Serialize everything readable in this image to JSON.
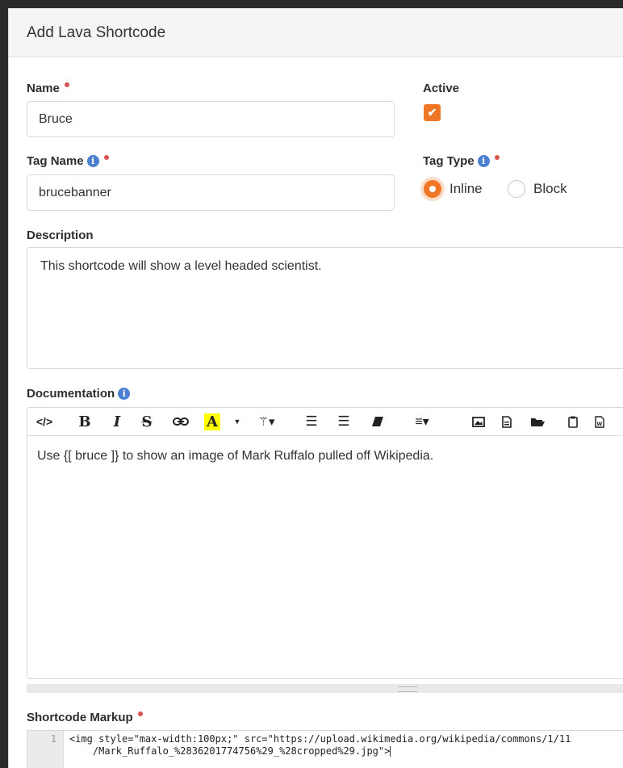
{
  "header": {
    "title": "Add Lava Shortcode"
  },
  "name": {
    "label": "Name",
    "value": "Bruce"
  },
  "active": {
    "label": "Active",
    "checked": true
  },
  "tag_name": {
    "label": "Tag Name",
    "value": "brucebanner"
  },
  "tag_type": {
    "label": "Tag Type",
    "options": [
      "Inline",
      "Block"
    ],
    "selected": "Inline"
  },
  "description": {
    "label": "Description",
    "value": "This shortcode will show a level headed scientist."
  },
  "documentation": {
    "label": "Documentation",
    "body": "Use {[ bruce ]} to show an image of Mark Ruffalo pulled off Wikipedia."
  },
  "markup": {
    "label": "Shortcode Markup",
    "line_number": "1",
    "line1": "<img style=\"max-width:100px;\" src=\"https://upload.wikimedia.org/wikipedia/commons/1/11",
    "line2": "    /Mark_Ruffalo_%2836201774756%29_%28cropped%29.jpg\">"
  },
  "colors": {
    "accent": "#ee7624",
    "required": "#d9534f",
    "info": "#4a7fd1"
  }
}
